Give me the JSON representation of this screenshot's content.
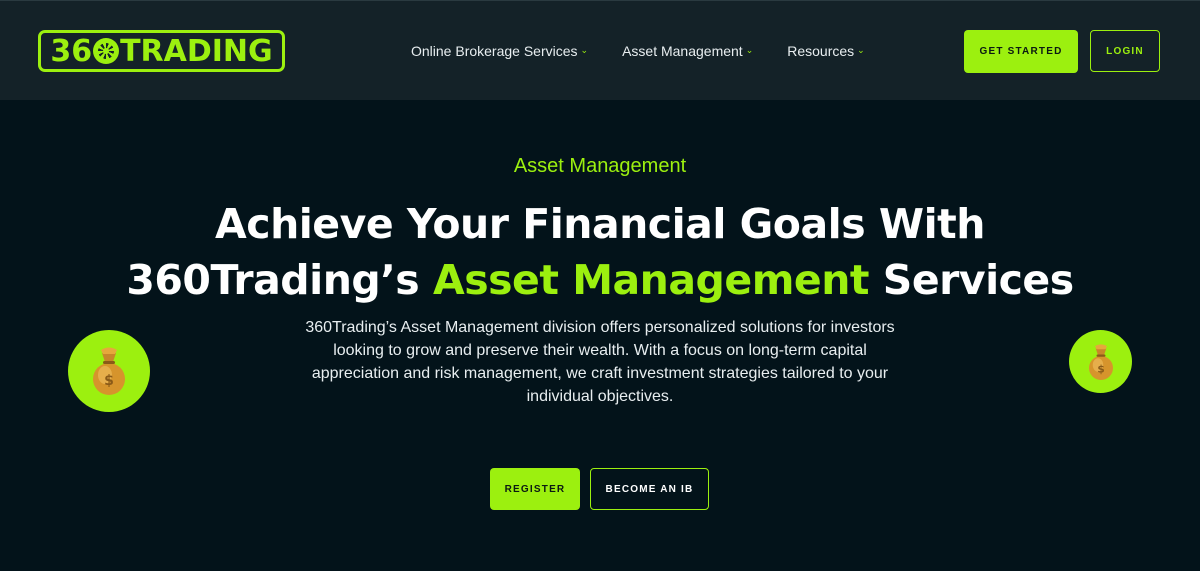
{
  "header": {
    "logo_text": "360TRADING",
    "logo_prefix": "36",
    "logo_suffix": "TRADING",
    "nav": [
      {
        "label": "Online Brokerage Services",
        "icon": "chevron-down-icon"
      },
      {
        "label": "Asset Management",
        "icon": "chevron-down-icon"
      },
      {
        "label": "Resources",
        "icon": "chevron-down-icon"
      }
    ],
    "get_started_label": "GET STARTED",
    "login_label": "LOGIN"
  },
  "hero": {
    "eyebrow": "Asset Management",
    "headline_line1": "Achieve Your Financial Goals With",
    "headline_line2_prefix": "360Trading’s ",
    "headline_line2_accent": "Asset Management",
    "headline_line2_suffix": " Services",
    "description": "360Trading’s Asset Management division offers personalized solutions for investors looking to grow and preserve their wealth. With a focus on long-term capital appreciation and risk management, we craft investment strategies tailored to your individual objectives.",
    "register_label": "REGISTER",
    "become_ib_label": "BECOME AN IB",
    "decor_icon_left": "money-bag-icon",
    "decor_icon_right": "money-bag-icon"
  },
  "colors": {
    "background": "#03131a",
    "header_bg": "#142228",
    "accent": "#9cf00f",
    "text": "#ffffff"
  }
}
